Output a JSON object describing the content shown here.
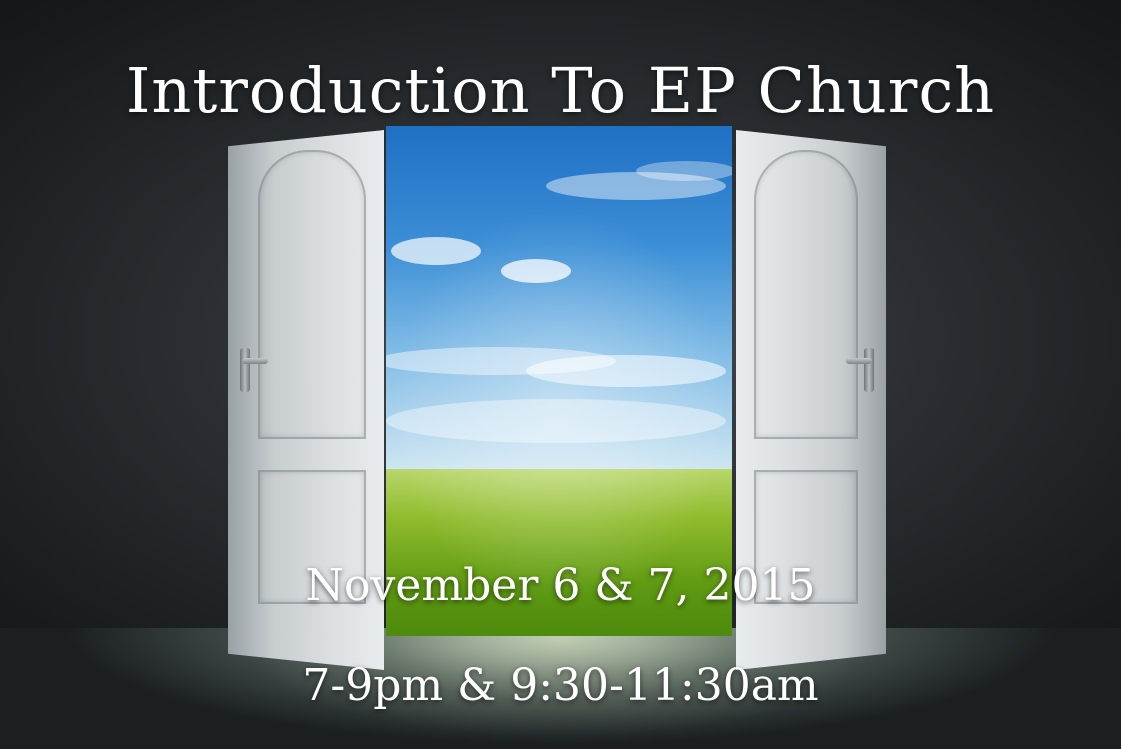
{
  "poster": {
    "title": "Introduction To EP Church",
    "date_line": "November 6 & 7, 2015",
    "time_line": "7-9pm & 9:30-11:30am"
  },
  "colors": {
    "background": "#2b2f33",
    "text": "#ffffff",
    "sky": "#3c8fd6",
    "grass": "#8fbb2c",
    "door": "#dde1e3"
  }
}
